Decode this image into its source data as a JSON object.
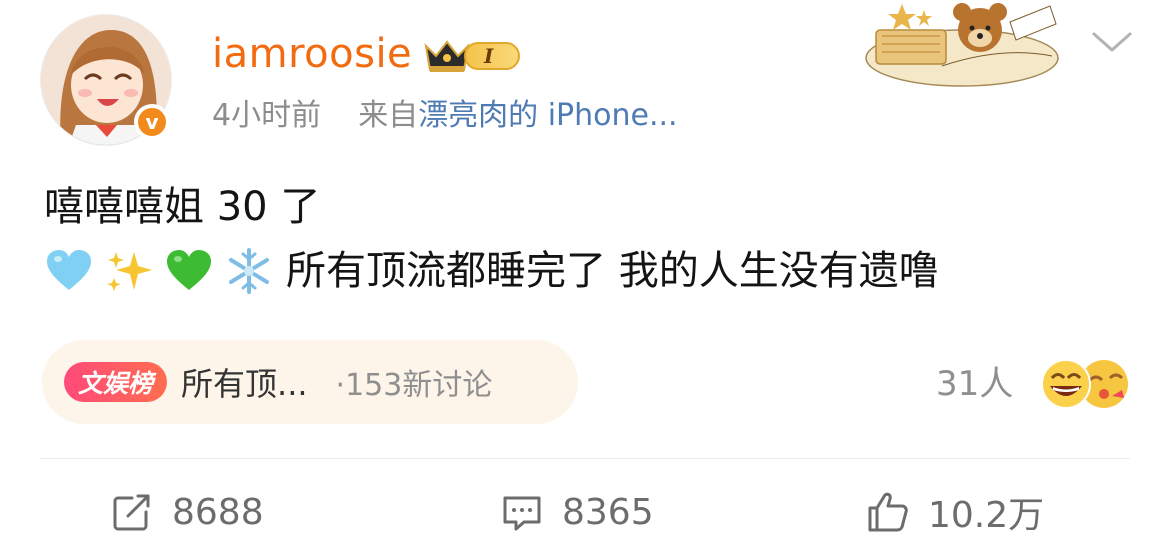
{
  "user": {
    "name": "iamroosie",
    "vip_level": "I",
    "verified": "v"
  },
  "meta": {
    "time": "4小时前",
    "source_prefix": "来自",
    "source": "漂亮肉的 iPhone..."
  },
  "post": {
    "line1": "嘻嘻嘻姐 30 了",
    "line2_emojis": [
      "blue-heart-icon",
      "sparkles-icon",
      "green-heart-icon",
      "snowflake-icon"
    ],
    "line2_text": "所有顶流都睡完了 我的人生没有遗噜"
  },
  "topic": {
    "tag": "文娱榜",
    "title": "所有顶...",
    "count": "·153新讨论"
  },
  "reactions": {
    "count": "31人",
    "emoji_icons": [
      "grin-face-icon",
      "blowing-kiss-face-icon"
    ]
  },
  "actions": {
    "repost": "8688",
    "comment": "8365",
    "like": "10.2万"
  },
  "colors": {
    "username": "#f26b10",
    "link": "#4f7bb5",
    "meta": "#8d8d8d",
    "topic_bg": "#fdf4ea",
    "topic_tag": "#ff4a7a"
  }
}
